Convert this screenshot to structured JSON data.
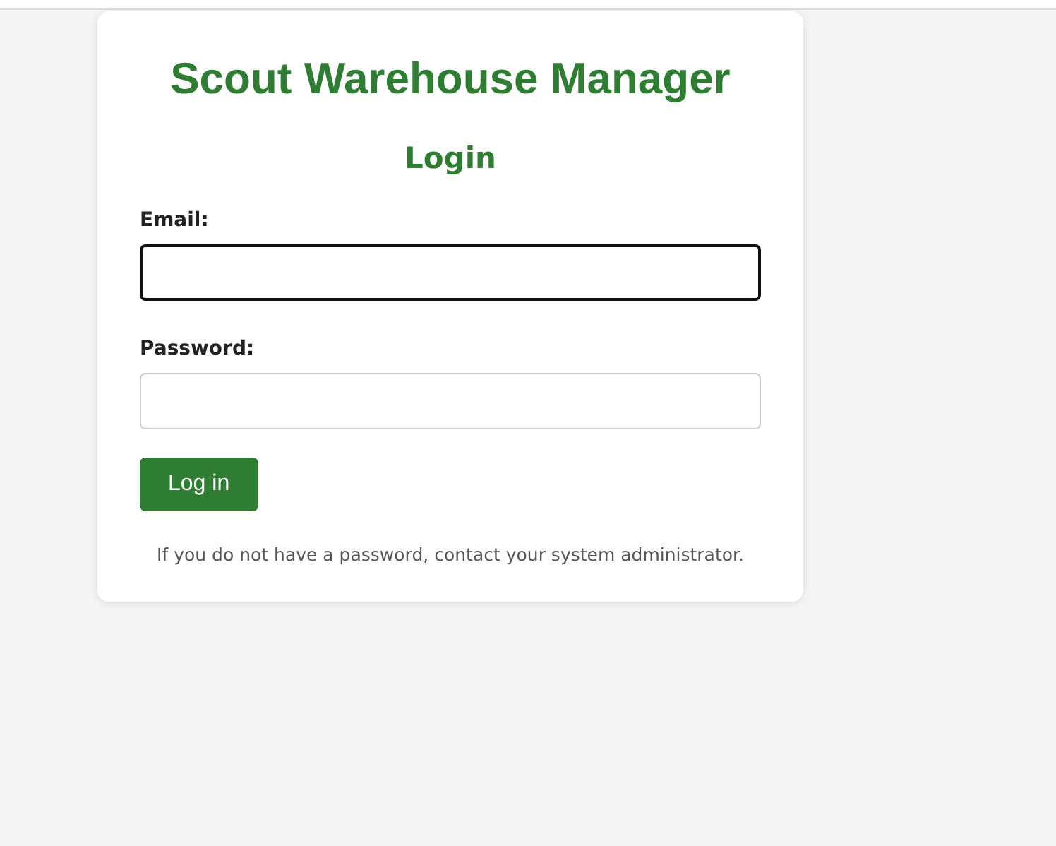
{
  "app_title": "Scout Warehouse Manager",
  "heading": "Login",
  "fields": [
    {
      "label": "Email:",
      "focused": true
    },
    {
      "label": "Password:",
      "focused": false
    }
  ],
  "submit_button": "Log in",
  "note": "If you do not have a password, contact your system administrator."
}
